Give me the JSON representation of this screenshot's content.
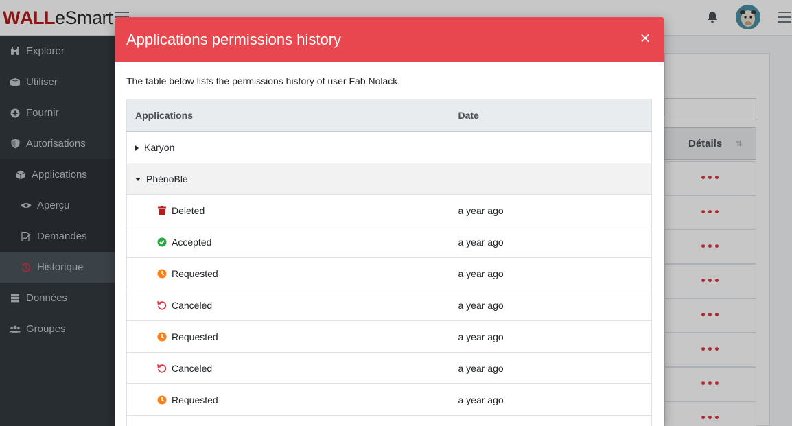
{
  "brand": {
    "name_prefix": "W",
    "name_accent": "ALL",
    "name_suffix": "eSmart"
  },
  "colors": {
    "modal_header": "#e8474f",
    "sidebar_bg": "#343a40",
    "deleted": "#b71c1c",
    "accepted": "#28a745",
    "requested": "#fd7e14",
    "canceled": "#dc3545"
  },
  "sidebar": {
    "items": [
      {
        "label": "Explorer",
        "icon": "binoculars-icon"
      },
      {
        "label": "Utiliser",
        "icon": "box-open-icon"
      },
      {
        "label": "Fournir",
        "icon": "plus-circle-icon"
      },
      {
        "label": "Autorisations",
        "icon": "shield-icon"
      },
      {
        "label": "Applications",
        "icon": "cube-icon"
      },
      {
        "label": "Aperçu",
        "icon": "eye-icon"
      },
      {
        "label": "Demandes",
        "icon": "file-signature-icon"
      },
      {
        "label": "Historique",
        "icon": "history-icon"
      },
      {
        "label": "Données",
        "icon": "database-icon"
      },
      {
        "label": "Groupes",
        "icon": "users-icon"
      }
    ]
  },
  "background": {
    "column_header": "Détails",
    "row_action": "•••"
  },
  "modal": {
    "title": "Applications permissions history",
    "close": "×",
    "description": "The table below lists the permissions history of user Fab Nolack.",
    "columns": [
      "Applications",
      "Date"
    ],
    "groups": [
      {
        "name": "Karyon",
        "expanded": false
      },
      {
        "name": "PhénoBlé",
        "expanded": true
      }
    ],
    "entries": [
      {
        "status": "Deleted",
        "date": "a year ago",
        "icon": "trash-icon"
      },
      {
        "status": "Accepted",
        "date": "a year ago",
        "icon": "check-circle-icon"
      },
      {
        "status": "Requested",
        "date": "a year ago",
        "icon": "clock-icon"
      },
      {
        "status": "Canceled",
        "date": "a year ago",
        "icon": "undo-icon"
      },
      {
        "status": "Requested",
        "date": "a year ago",
        "icon": "clock-icon"
      },
      {
        "status": "Canceled",
        "date": "a year ago",
        "icon": "undo-icon"
      },
      {
        "status": "Requested",
        "date": "a year ago",
        "icon": "clock-icon"
      }
    ]
  }
}
